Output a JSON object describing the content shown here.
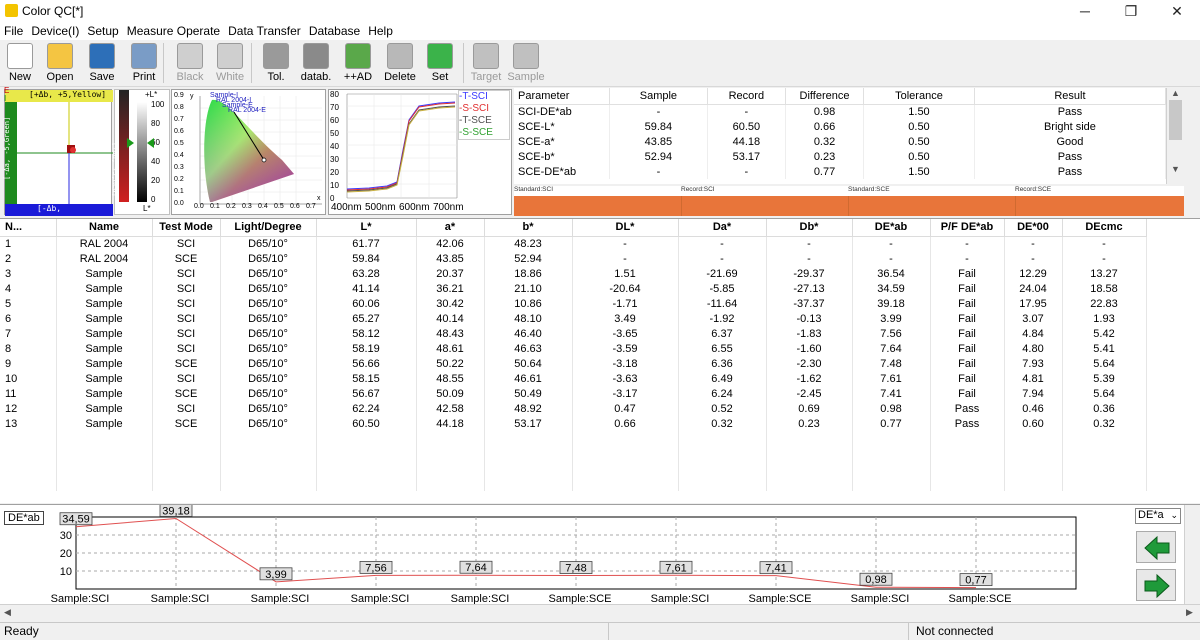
{
  "window": {
    "title": "Color QC[*]",
    "minimize": "─",
    "maximize": "❐",
    "close": "✕"
  },
  "menu": [
    "File",
    "Device(I)",
    "Setup",
    "Measure Operate",
    "Data Transfer",
    "Database",
    "Help"
  ],
  "toolbar": [
    {
      "label": "New",
      "color": "#ffffff",
      "disabled": false
    },
    {
      "label": "Open",
      "color": "#f4c542",
      "disabled": false
    },
    {
      "label": "Save",
      "color": "#2d6fb8",
      "disabled": false
    },
    {
      "label": "Print",
      "color": "#7a9cc6",
      "disabled": false
    },
    {
      "label": "Black",
      "color": "#cfcfcf",
      "disabled": true
    },
    {
      "label": "White",
      "color": "#cfcfcf",
      "disabled": true
    },
    {
      "label": "Tol.",
      "color": "#9a9a9a",
      "disabled": false
    },
    {
      "label": "datab.",
      "color": "#8a8a8a",
      "disabled": false
    },
    {
      "label": "++AD",
      "color": "#5aa84a",
      "disabled": false
    },
    {
      "label": "Delete",
      "color": "#b8b8b8",
      "disabled": false
    },
    {
      "label": "Set",
      "color": "#3bb34a",
      "disabled": false
    },
    {
      "label": "Target",
      "color": "#c0c0c0",
      "disabled": true
    },
    {
      "label": "Sample",
      "color": "#c0c0c0",
      "disabled": true
    }
  ],
  "ab_plot": {
    "top_label": "[+Δb, +5,Yellow]",
    "bottom_label": "[-Δb,",
    "left_label": "[-Δa, -5,Green]",
    "right_label": "[+Δa, +5,Red]",
    "legend_E": "E",
    "legend_I": "I"
  },
  "l_scale": {
    "top": "+L*",
    "bottom": "L*",
    "ticks": [
      "100",
      "80",
      "60",
      "40",
      "20",
      "0"
    ]
  },
  "chroma": {
    "points": [
      "Sample-I",
      "RAL 2004-I",
      "Sample-E",
      "RAL 2004-E"
    ],
    "y_label": "y",
    "x_ticks": [
      "0.0",
      "0.1",
      "0.2",
      "0.3",
      "0.4",
      "0.5",
      "0.6",
      "0.7"
    ],
    "x_label": "x",
    "y_ticks": [
      "0.9",
      "0.8",
      "0.7",
      "0.6",
      "0.5",
      "0.4",
      "0.3",
      "0.2",
      "0.1",
      "0.0"
    ]
  },
  "spectral": {
    "y_ticks": [
      "80",
      "70",
      "60",
      "50",
      "40",
      "30",
      "20",
      "10",
      "0"
    ],
    "x_ticks": [
      "400nm",
      "500nm",
      "600nm",
      "700nm"
    ],
    "legend": [
      {
        "name": "T-SCI",
        "color": "#3a3aff"
      },
      {
        "name": "S-SCI",
        "color": "#e03030"
      },
      {
        "name": "T-SCE",
        "color": "#505050"
      },
      {
        "name": "S-SCE",
        "color": "#30a030"
      }
    ]
  },
  "params": {
    "headers": [
      "Parameter",
      "Sample",
      "Record",
      "Difference",
      "Tolerance",
      "Result"
    ],
    "rows": [
      [
        "SCI-DE*ab",
        "-",
        "-",
        "0.98",
        "1.50",
        "Pass"
      ],
      [
        "SCE-L*",
        "59.84",
        "60.50",
        "0.66",
        "0.50",
        "Bright side"
      ],
      [
        "SCE-a*",
        "43.85",
        "44.18",
        "0.32",
        "0.50",
        "Good"
      ],
      [
        "SCE-b*",
        "52.94",
        "53.17",
        "0.23",
        "0.50",
        "Pass"
      ],
      [
        "SCE-DE*ab",
        "-",
        "-",
        "0.77",
        "1.50",
        "Pass"
      ]
    ]
  },
  "ref_labels": [
    "Standard:SCI",
    "Record:SCI",
    "Standard:SCE",
    "Record:SCE"
  ],
  "table": {
    "headers": [
      "N...",
      "Name",
      "Test Mode",
      "Light/Degree",
      "L*",
      "a*",
      "b*",
      "DL*",
      "Da*",
      "Db*",
      "DE*ab",
      "P/F DE*ab",
      "DE*00",
      "DEcmc"
    ],
    "rows": [
      [
        "1",
        "RAL 2004",
        "SCI",
        "D65/10°",
        "61.77",
        "42.06",
        "48.23",
        "-",
        "-",
        "-",
        "-",
        "-",
        "-",
        "-"
      ],
      [
        "2",
        "RAL 2004",
        "SCE",
        "D65/10°",
        "59.84",
        "43.85",
        "52.94",
        "-",
        "-",
        "-",
        "-",
        "-",
        "-",
        "-"
      ],
      [
        "3",
        "Sample",
        "SCI",
        "D65/10°",
        "63.28",
        "20.37",
        "18.86",
        "1.51",
        "-21.69",
        "-29.37",
        "36.54",
        "Fail",
        "12.29",
        "13.27"
      ],
      [
        "4",
        "Sample",
        "SCI",
        "D65/10°",
        "41.14",
        "36.21",
        "21.10",
        "-20.64",
        "-5.85",
        "-27.13",
        "34.59",
        "Fail",
        "24.04",
        "18.58"
      ],
      [
        "5",
        "Sample",
        "SCI",
        "D65/10°",
        "60.06",
        "30.42",
        "10.86",
        "-1.71",
        "-11.64",
        "-37.37",
        "39.18",
        "Fail",
        "17.95",
        "22.83"
      ],
      [
        "6",
        "Sample",
        "SCI",
        "D65/10°",
        "65.27",
        "40.14",
        "48.10",
        "3.49",
        "-1.92",
        "-0.13",
        "3.99",
        "Fail",
        "3.07",
        "1.93"
      ],
      [
        "7",
        "Sample",
        "SCI",
        "D65/10°",
        "58.12",
        "48.43",
        "46.40",
        "-3.65",
        "6.37",
        "-1.83",
        "7.56",
        "Fail",
        "4.84",
        "5.42"
      ],
      [
        "8",
        "Sample",
        "SCI",
        "D65/10°",
        "58.19",
        "48.61",
        "46.63",
        "-3.59",
        "6.55",
        "-1.60",
        "7.64",
        "Fail",
        "4.80",
        "5.41"
      ],
      [
        "9",
        "Sample",
        "SCE",
        "D65/10°",
        "56.66",
        "50.22",
        "50.64",
        "-3.18",
        "6.36",
        "-2.30",
        "7.48",
        "Fail",
        "7.93",
        "5.64"
      ],
      [
        "10",
        "Sample",
        "SCI",
        "D65/10°",
        "58.15",
        "48.55",
        "46.61",
        "-3.63",
        "6.49",
        "-1.62",
        "7.61",
        "Fail",
        "4.81",
        "5.39"
      ],
      [
        "11",
        "Sample",
        "SCE",
        "D65/10°",
        "56.67",
        "50.09",
        "50.49",
        "-3.17",
        "6.24",
        "-2.45",
        "7.41",
        "Fail",
        "7.94",
        "5.64"
      ],
      [
        "12",
        "Sample",
        "SCI",
        "D65/10°",
        "62.24",
        "42.58",
        "48.92",
        "0.47",
        "0.52",
        "0.69",
        "0.98",
        "Pass",
        "0.46",
        "0.36"
      ],
      [
        "13",
        "Sample",
        "SCE",
        "D65/10°",
        "60.50",
        "44.18",
        "53.17",
        "0.66",
        "0.32",
        "0.23",
        "0.77",
        "Pass",
        "0.60",
        "0.32"
      ]
    ]
  },
  "trend": {
    "label": "DE*ab",
    "selector": "DE*a",
    "y_ticks": [
      "30",
      "20",
      "10"
    ],
    "points": [
      {
        "value": "34,59",
        "name": "Sample:SCI",
        "v": 34.59
      },
      {
        "value": "39,18",
        "name": "Sample:SCI",
        "v": 39.18
      },
      {
        "value": "3,99",
        "name": "Sample:SCI",
        "v": 3.99
      },
      {
        "value": "7,56",
        "name": "Sample:SCI",
        "v": 7.56
      },
      {
        "value": "7,64",
        "name": "Sample:SCI",
        "v": 7.64
      },
      {
        "value": "7,48",
        "name": "Sample:SCE",
        "v": 7.48
      },
      {
        "value": "7,61",
        "name": "Sample:SCI",
        "v": 7.61
      },
      {
        "value": "7,41",
        "name": "Sample:SCE",
        "v": 7.41
      },
      {
        "value": "0,98",
        "name": "Sample:SCI",
        "v": 0.98
      },
      {
        "value": "0,77",
        "name": "Sample:SCE",
        "v": 0.77
      }
    ]
  },
  "status": {
    "left": "Ready",
    "right": "Not connected"
  }
}
